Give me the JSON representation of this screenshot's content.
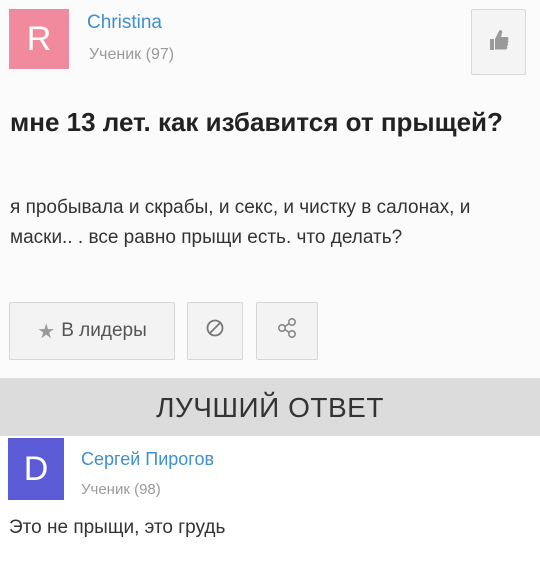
{
  "question": {
    "author": {
      "initial": "R",
      "name": "Christina",
      "rank": "Ученик (97)",
      "avatar_color": "#f08a9c"
    },
    "title": "мне 13 лет. как избавится от прыщей?",
    "body": "я пробывала и скрабы, и секс, и чистку в салонах, и маски.. . все равно прыщи есть. что делать?",
    "actions": {
      "leaders_label": "В лидеры",
      "like_icon": "thumbs-up-icon",
      "block_icon": "block-icon",
      "share_icon": "share-icon"
    }
  },
  "best_answer": {
    "banner": "ЛУЧШИЙ ОТВЕТ",
    "author": {
      "initial": "D",
      "name": "Сергей Пирогов",
      "rank": "Ученик (98)",
      "avatar_color": "#5b5bd6"
    },
    "text": "Это не прыщи, это грудь"
  },
  "colors": {
    "link": "#3f8fd1",
    "banner_bg": "#dcdcdc"
  }
}
